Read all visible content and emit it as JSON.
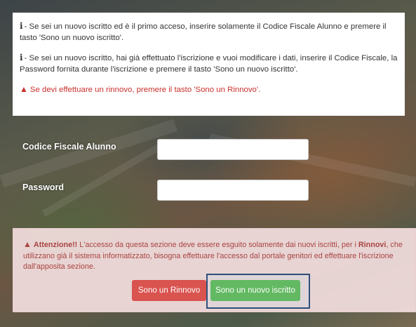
{
  "info": {
    "line1": "- Se sei un nuovo iscritto ed è il primo acceso, inserire solamente il Codice Fiscale Alunno e premere il tasto 'Sono un nuovo iscritto'.",
    "line2": "- Se sei un nuovo iscritto, hai già effettuato l'iscrizione e vuoi modificare i dati, inserire il Codice Fiscale, la Password fornita durante l'iscrizione e premere il tasto 'Sono un nuovo iscritto'.",
    "line3": "Se devi effettuare un rinnovo, premere il tasto 'Sono un Rinnovo'.",
    "info_icon_glyph": "i",
    "warning_icon_glyph": "▲"
  },
  "form": {
    "codice_fiscale_label": "Codice Fiscale Alunno",
    "codice_fiscale_value": "",
    "password_label": "Password",
    "password_value": ""
  },
  "alert": {
    "title": "Attenzione!!",
    "text_part1": " L'accesso da questa sezione deve essere esguito solamente dai nuovi iscritti, per i ",
    "highlight": "Rinnovi",
    "text_part2": ", che utilizzano già il sistema informatizzato, bisogna effettuare l'accesso dal portale genitori ed effettuare l'iscrizione dall'apposita sezione."
  },
  "buttons": {
    "renewal_label": "Sono un Rinnovo",
    "new_label": "Sono un nuovo iscritto"
  },
  "colors": {
    "danger": "#d9534f",
    "success": "#5cb85c",
    "alert_text": "#a94442",
    "alert_bg": "#f2dede"
  }
}
